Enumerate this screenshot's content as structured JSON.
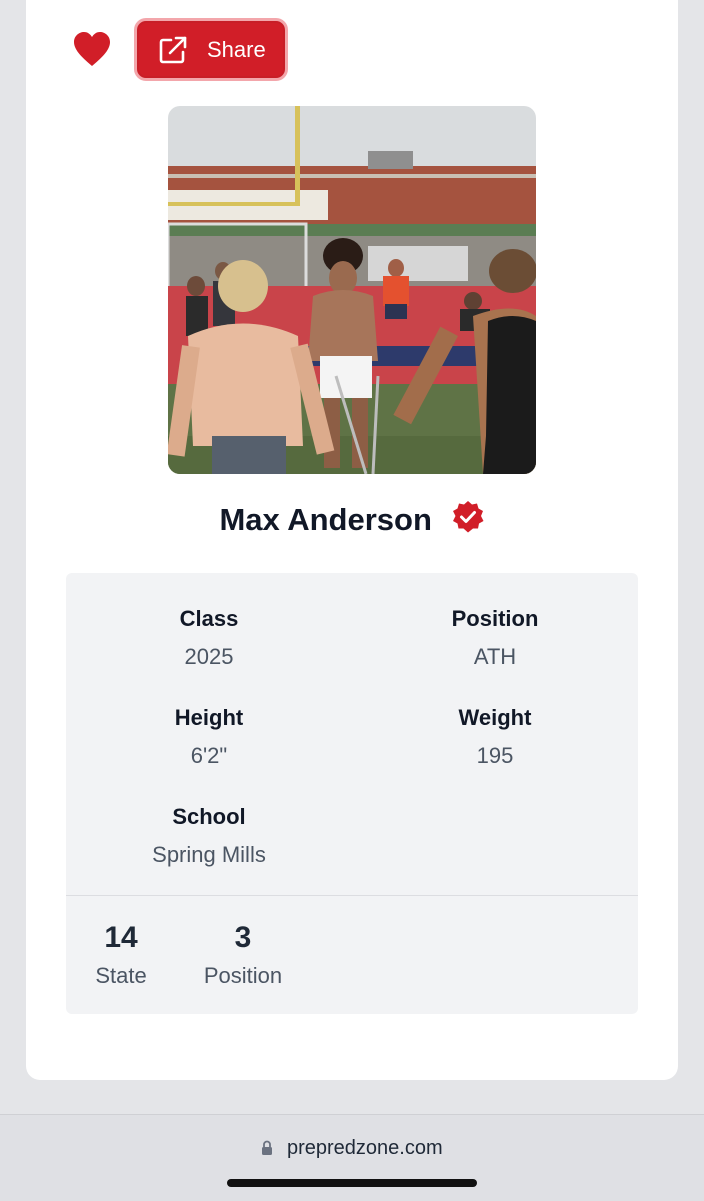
{
  "actions": {
    "share_label": "Share"
  },
  "profile": {
    "name": "Max Anderson",
    "photo_description": "athletes on a red and green field"
  },
  "details": [
    {
      "label": "Class",
      "value": "2025"
    },
    {
      "label": "Position",
      "value": "ATH"
    },
    {
      "label": "Height",
      "value": "6'2\""
    },
    {
      "label": "Weight",
      "value": "195"
    },
    {
      "label": "School",
      "value": "Spring Mills"
    }
  ],
  "rankings": [
    {
      "value": "14",
      "label": "State"
    },
    {
      "value": "3",
      "label": "Position"
    }
  ],
  "browser": {
    "url": "prepredzone.com"
  },
  "colors": {
    "accent": "#d11e28",
    "text": "#111827",
    "muted": "#4b5563",
    "panel": "#f2f3f5"
  },
  "icons": [
    "heart-icon",
    "external-link-icon",
    "verified-badge-icon",
    "lock-icon"
  ]
}
